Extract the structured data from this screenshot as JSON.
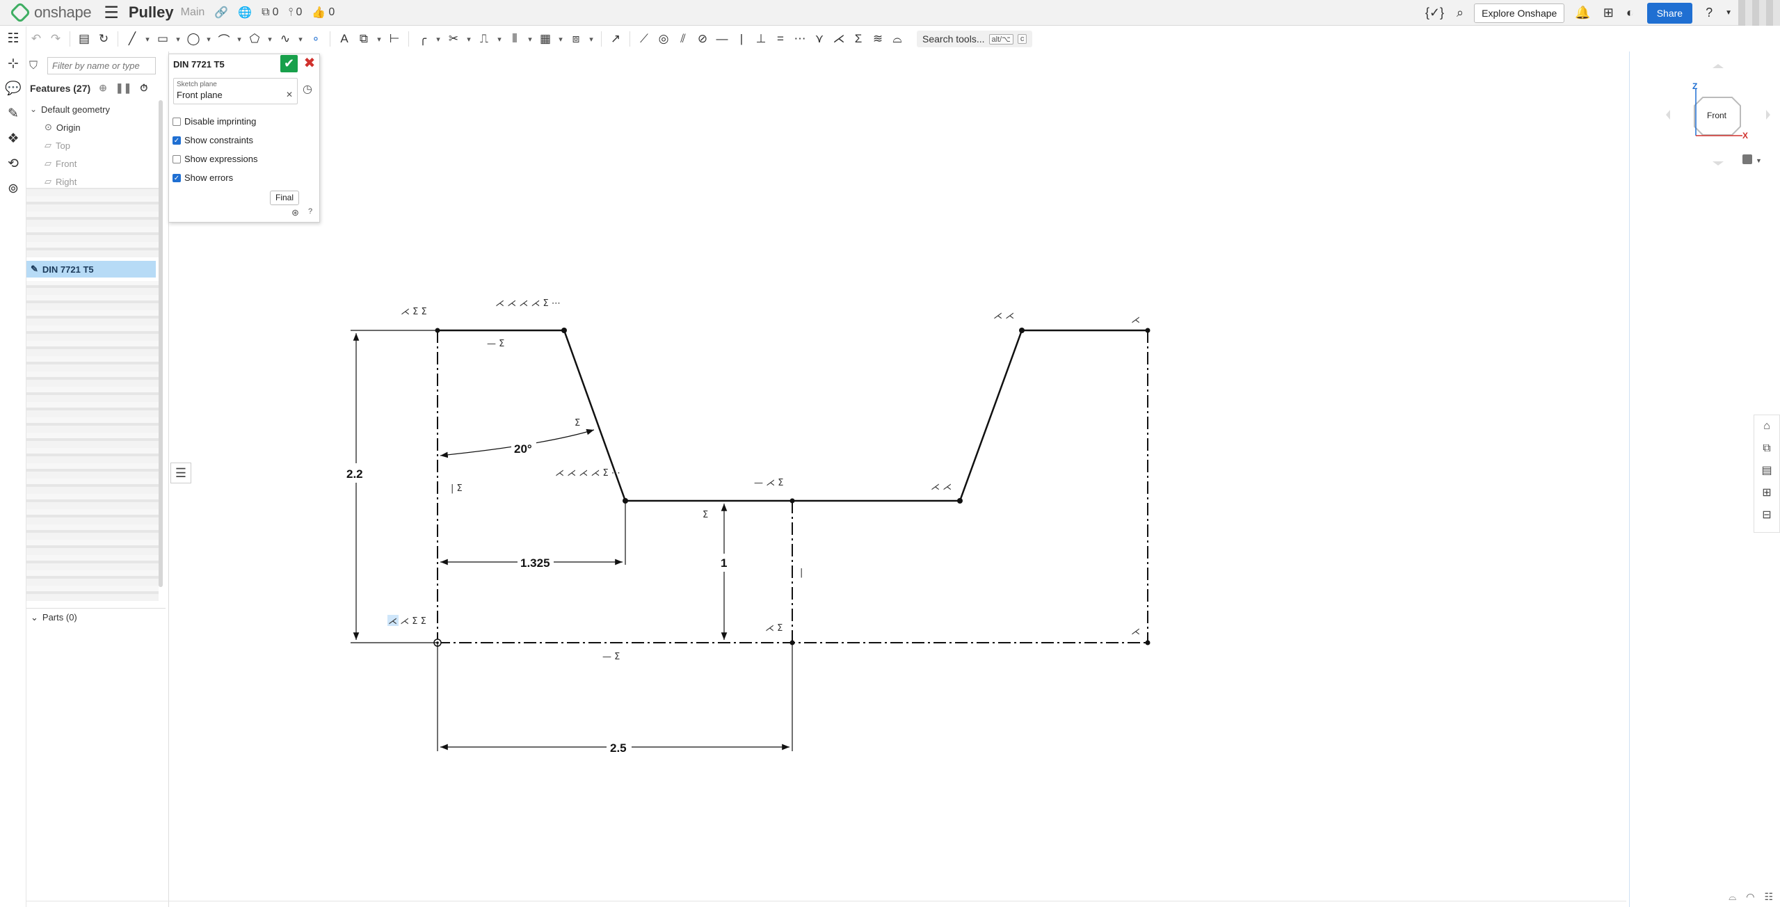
{
  "app": {
    "logo_text": "onshape",
    "doc_title": "Pulley",
    "branch": "Main",
    "versions_count": "0",
    "branches_count": "0",
    "likes_count": "0",
    "explore_label": "Explore Onshape",
    "share_label": "Share",
    "help_glyph": "?"
  },
  "toolbar": {
    "search_label": "Search tools...",
    "search_shortcut": "alt/⌥",
    "search_shortcut2": "c"
  },
  "features": {
    "filter_placeholder": "Filter by name or type",
    "header": "Features (27)",
    "default_geometry": "Default geometry",
    "origin": "Origin",
    "top": "Top",
    "front": "Front",
    "right": "Right",
    "selected_feature": "DIN 7721 T5",
    "parts": "Parts (0)"
  },
  "sketch_dialog": {
    "title": "DIN 7721 T5",
    "plane_label": "Sketch plane",
    "plane_value": "Front plane",
    "opt_disable_imprinting": "Disable imprinting",
    "opt_show_constraints": "Show constraints",
    "opt_show_expressions": "Show expressions",
    "opt_show_errors": "Show errors",
    "final_label": "Final",
    "checks": {
      "disable_imprinting": false,
      "show_constraints": true,
      "show_expressions": false,
      "show_errors": true
    }
  },
  "sketch": {
    "dim_height": "2.2",
    "dim_angle": "20°",
    "dim_width1": "1.325",
    "dim_depth": "1",
    "dim_width2": "2.5"
  },
  "viewcube": {
    "face_label": "Front",
    "axis_z": "Z",
    "axis_x": "X"
  },
  "colors": {
    "accent": "#1f6fd2",
    "ok": "#18a04b",
    "cancel": "#d0312d",
    "selection": "#b7dbf6",
    "logo": "#3fae63"
  }
}
